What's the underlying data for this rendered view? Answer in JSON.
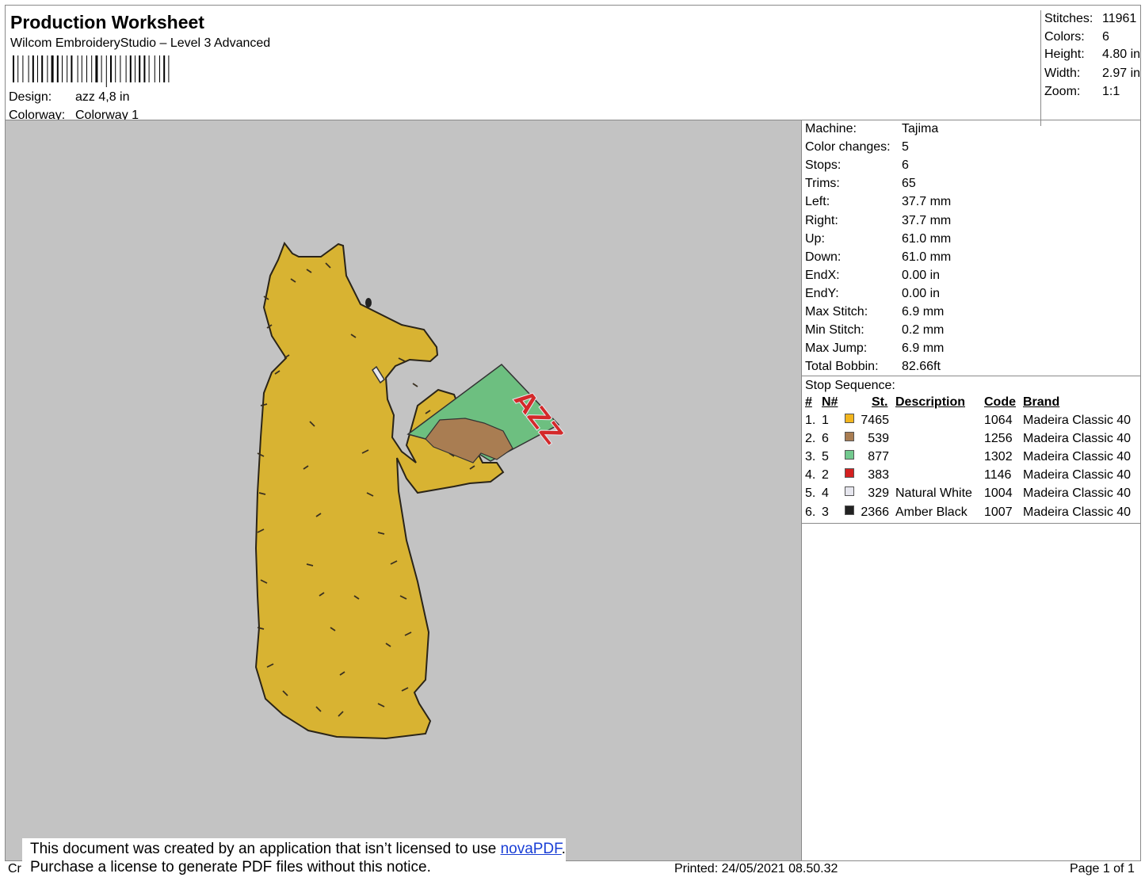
{
  "header": {
    "title": "Production Worksheet",
    "subtitle": "Wilcom EmbroideryStudio – Level 3 Advanced",
    "design_label": "Design:",
    "design_value": "azz 4,8 in",
    "colorway_label": "Colorway:",
    "colorway_value": "Colorway 1"
  },
  "summary": [
    {
      "label": "Stitches:",
      "value": "11961"
    },
    {
      "label": "Colors:",
      "value": "6"
    },
    {
      "label": "Height:",
      "value": "4.80 in"
    },
    {
      "label": "Width:",
      "value": "2.97 in"
    },
    {
      "label": "Zoom:",
      "value": "1:1"
    }
  ],
  "design_artwork": {
    "magazine_text": "AZZ",
    "colors": {
      "body": "#d8b332",
      "brown": "#a97d52",
      "green": "#6dbf80",
      "red": "#d4292a",
      "white": "#e8e8ee",
      "black": "#222222",
      "background": "#c3c3c3"
    }
  },
  "machine_info": [
    {
      "label": "Machine:",
      "value": "Tajima"
    },
    {
      "label": "Color changes:",
      "value": "5"
    },
    {
      "label": "Stops:",
      "value": "6"
    },
    {
      "label": "Trims:",
      "value": "65"
    },
    {
      "label": "Left:",
      "value": "37.7 mm"
    },
    {
      "label": "Right:",
      "value": "37.7 mm"
    },
    {
      "label": "Up:",
      "value": "61.0 mm"
    },
    {
      "label": "Down:",
      "value": "61.0 mm"
    },
    {
      "label": "EndX:",
      "value": "0.00 in"
    },
    {
      "label": "EndY:",
      "value": "0.00 in"
    },
    {
      "label": "Max Stitch:",
      "value": "6.9 mm"
    },
    {
      "label": "Min Stitch:",
      "value": "0.2 mm"
    },
    {
      "label": "Max Jump:",
      "value": "6.9 mm"
    },
    {
      "label": "Total Bobbin:",
      "value": "82.66ft"
    }
  ],
  "stop_sequence": {
    "title": "Stop Sequence:",
    "headers": {
      "num": "#",
      "n": "N#",
      "st": "St.",
      "description": "Description",
      "code": "Code",
      "brand": "Brand"
    },
    "rows": [
      {
        "num": "1.",
        "n": "1",
        "color": "#f2b51e",
        "st": "7465",
        "description": "",
        "code": "1064",
        "brand": "Madeira Classic 40"
      },
      {
        "num": "2.",
        "n": "6",
        "color": "#a97d52",
        "st": "539",
        "description": "",
        "code": "1256",
        "brand": "Madeira Classic 40"
      },
      {
        "num": "3.",
        "n": "5",
        "color": "#72c98e",
        "st": "877",
        "description": "",
        "code": "1302",
        "brand": "Madeira Classic 40"
      },
      {
        "num": "4.",
        "n": "2",
        "color": "#d42020",
        "st": "383",
        "description": "",
        "code": "1146",
        "brand": "Madeira Classic 40"
      },
      {
        "num": "5.",
        "n": "4",
        "color": "#e6e6ee",
        "st": "329",
        "description": "Natural White",
        "code": "1004",
        "brand": "Madeira Classic 40"
      },
      {
        "num": "6.",
        "n": "3",
        "color": "#222222",
        "st": "2366",
        "description": "Amber Black",
        "code": "1007",
        "brand": "Madeira Classic 40"
      }
    ]
  },
  "footer": {
    "created_prefix": "Cr",
    "printed": "Printed: 24/05/2021 08.50.32",
    "page": "Page 1 of 1"
  },
  "notice": {
    "line1_prefix": "This document was created by an application that isn’t licensed to use ",
    "link": "novaPDF",
    "line1_suffix": ".",
    "line2": "Purchase a license to generate PDF files without this notice."
  }
}
